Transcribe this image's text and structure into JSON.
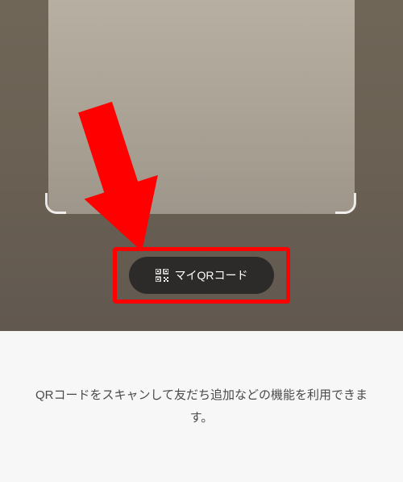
{
  "button": {
    "myqr_label": "マイQRコード"
  },
  "instruction": {
    "text": "QRコードをスキャンして友だち追加などの機能を利用できます。"
  },
  "colors": {
    "annotation_red": "#ff0000",
    "button_bg": "rgba(30,30,30,0.78)",
    "bottom_bg": "#f7f7f7"
  }
}
